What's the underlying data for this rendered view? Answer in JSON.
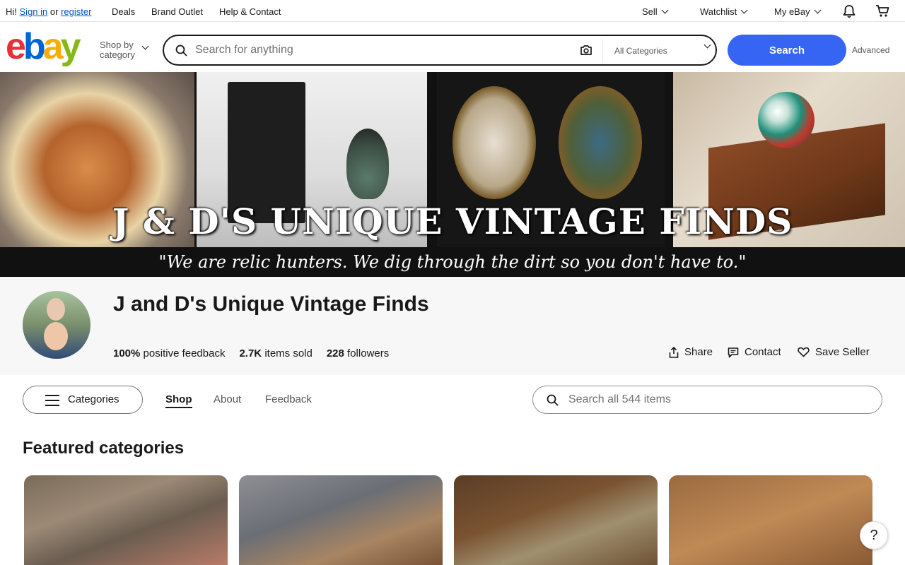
{
  "topbar": {
    "greeting": "Hi!",
    "sign_in": "Sign in",
    "or": "or",
    "register": "register",
    "deals": "Deals",
    "brand_outlet": "Brand Outlet",
    "help": "Help & Contact",
    "sell": "Sell",
    "watchlist": "Watchlist",
    "myebay": "My eBay"
  },
  "header": {
    "logo": {
      "e": "e",
      "b": "b",
      "a": "a",
      "y": "y"
    },
    "shop_by": "Shop by",
    "category": "category",
    "search_placeholder": "Search for anything",
    "all_categories": "All Categories",
    "search_button": "Search",
    "advanced": "Advanced"
  },
  "banner": {
    "title": "J & D'S UNIQUE VINTAGE FINDS",
    "tagline": "\"We are relic hunters. We dig through the dirt so you don't have to.\""
  },
  "store": {
    "name": "J and D's Unique Vintage Finds",
    "feedback_value": "100%",
    "feedback_label": "positive feedback",
    "sold_value": "2.7K",
    "sold_label": "items sold",
    "followers_value": "228",
    "followers_label": "followers",
    "share": "Share",
    "contact": "Contact",
    "save_seller": "Save Seller"
  },
  "tabs": {
    "categories": "Categories",
    "shop": "Shop",
    "about": "About",
    "feedback": "Feedback",
    "search_placeholder": "Search all 544 items"
  },
  "featured": {
    "title": "Featured categories"
  },
  "help": "?"
}
